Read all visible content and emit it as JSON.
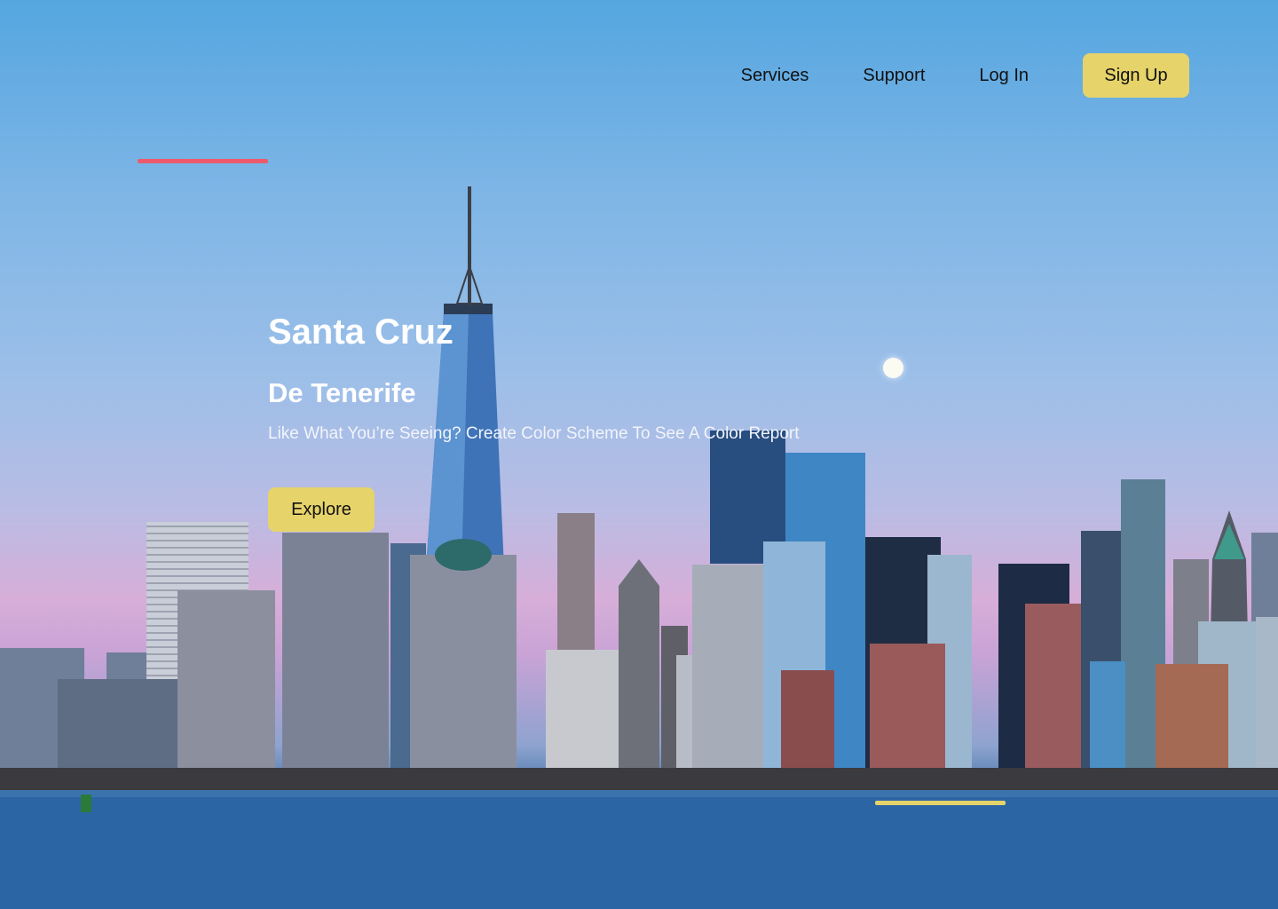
{
  "nav": {
    "services_label": "Services",
    "support_label": "Support",
    "login_label": "Log In",
    "signup_label": "Sign Up"
  },
  "hero": {
    "title": "Santa Cruz",
    "subtitle": "De Tenerife",
    "tagline": "Like What You’re Seeing? Create Color Scheme To See A Color Report",
    "explore_label": "Explore",
    "background_image": "city-skyline-at-dusk"
  },
  "colors": {
    "accent_yellow": "#e6d36a",
    "accent_red": "#ec5b6c",
    "text_white": "#ffffff",
    "text_dark": "#111111"
  }
}
